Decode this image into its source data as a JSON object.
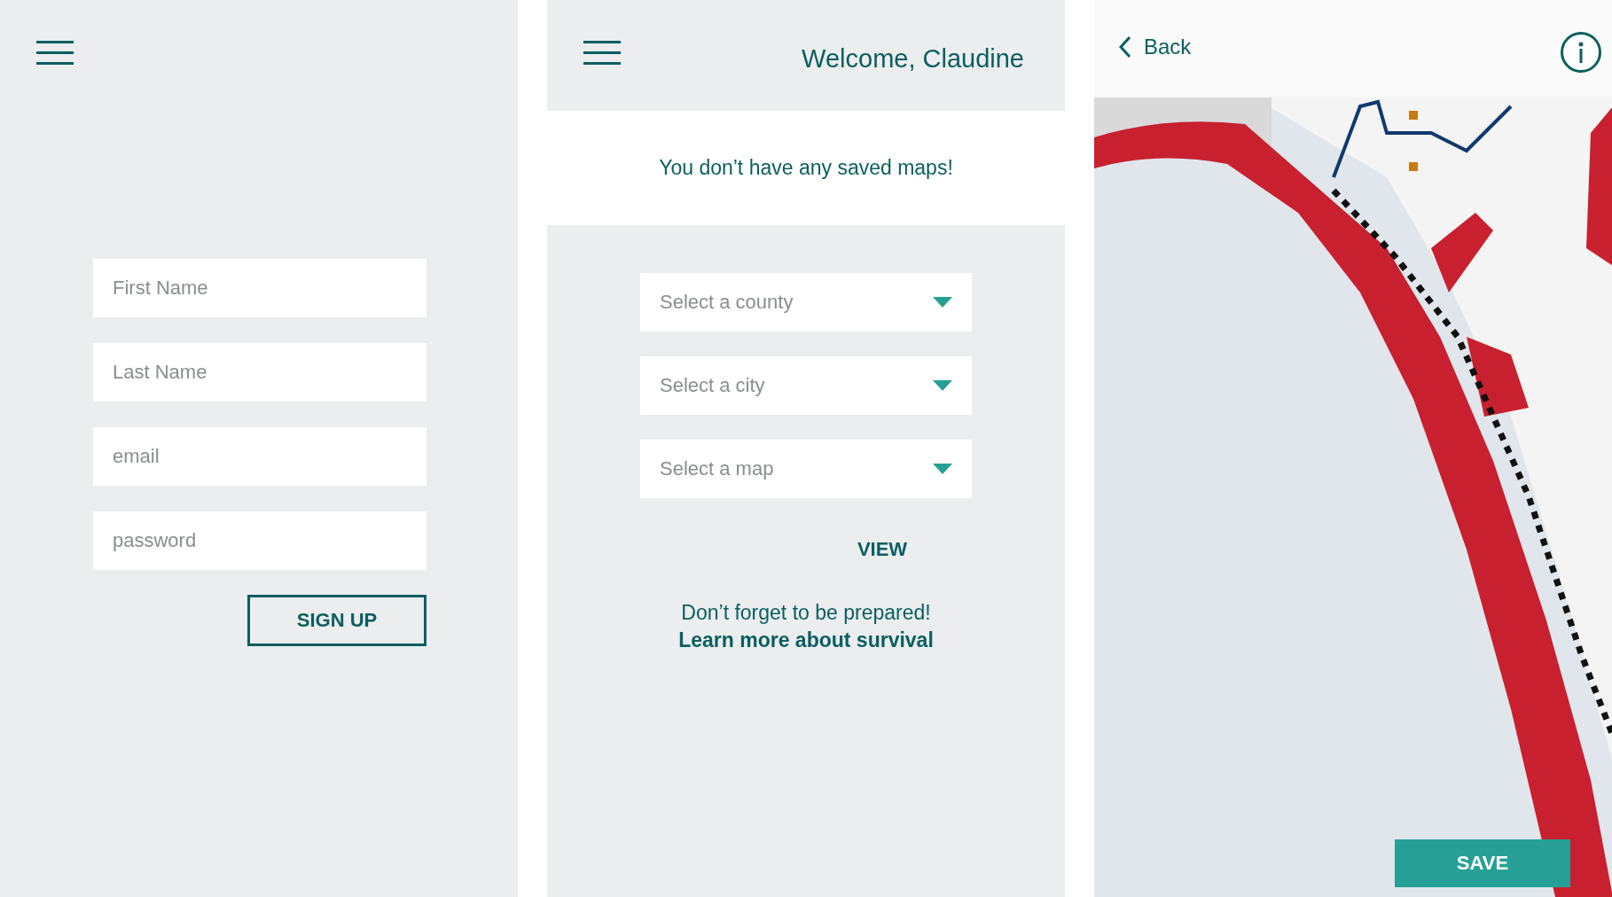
{
  "signup": {
    "fields": [
      {
        "placeholder": "First Name"
      },
      {
        "placeholder": "Last Name"
      },
      {
        "placeholder": "email"
      },
      {
        "placeholder": "password"
      }
    ],
    "button": "SIGN UP"
  },
  "home": {
    "title": "Welcome, Claudine",
    "notice": "You don’t have any saved maps!",
    "selects": [
      {
        "placeholder": "Select a county"
      },
      {
        "placeholder": "Select a city"
      },
      {
        "placeholder": "Select a map"
      }
    ],
    "button": "VIEW",
    "reminder": {
      "text": "Don’t forget to be prepared!",
      "link": "Learn more about survival"
    }
  },
  "map": {
    "back": "Back",
    "button": "SAVE"
  }
}
